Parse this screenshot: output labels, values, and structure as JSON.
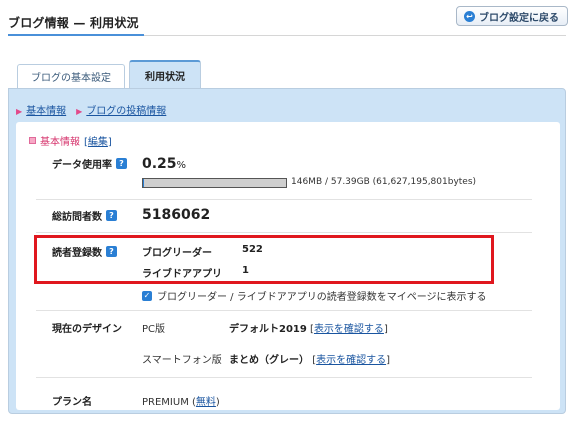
{
  "header": {
    "title": "ブログ情報 — 利用状況",
    "back_button": "ブログ設定に戻る"
  },
  "tabs": [
    {
      "label": "ブログの基本設定"
    },
    {
      "label": "利用状況"
    }
  ],
  "subnav": [
    {
      "label": "基本情報"
    },
    {
      "label": "ブログの投稿情報"
    }
  ],
  "section": {
    "title": "基本情報",
    "edit_open": "[",
    "edit_label": "編集",
    "edit_close": "]"
  },
  "data_usage": {
    "label": "データ使用率",
    "help_icon": "?",
    "value": "0.25",
    "unit": "%",
    "fraction": 0.0025,
    "detail": "146MB / 57.39GB (61,627,195,801bytes)"
  },
  "visits": {
    "label": "総訪問者数",
    "help_icon": "?",
    "value": "5186062"
  },
  "readers": {
    "label": "読者登録数",
    "help_icon": "?",
    "rows": [
      {
        "name": "ブログリーダー",
        "count": "522"
      },
      {
        "name": "ライブドアアプリ",
        "count": "1"
      }
    ],
    "checkbox_label": "ブログリーダー / ライブドアアプリの読者登録数をマイページに表示する",
    "checked": true
  },
  "design": {
    "label": "現在のデザイン",
    "pc_label": "PC版",
    "pc_value": "デフォルト2019",
    "pc_link": "表示を確認する",
    "sp_label": "スマートフォン版",
    "sp_value": "まとめ（グレー）",
    "sp_link": "表示を確認する"
  },
  "plan": {
    "label": "プラン名",
    "value": "PREMIUM",
    "link": "無料"
  }
}
